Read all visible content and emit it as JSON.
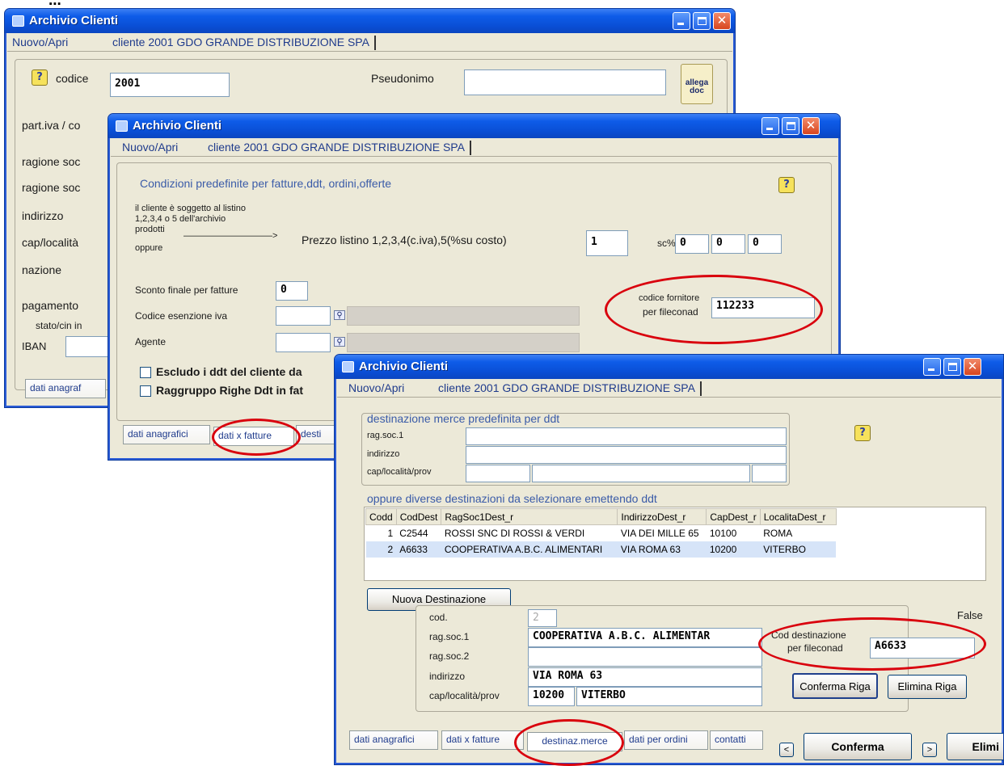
{
  "caption": "...",
  "windows": [
    {
      "title": "Archivio Clienti",
      "menu": {
        "open": "Nuovo/Apri",
        "client": "cliente 2001 GDO GRANDE DISTRIBUZIONE SPA"
      },
      "fields": {
        "codice_label": "codice",
        "codice_value": "2001",
        "pseudonimo_label": "Pseudonimo",
        "pseudonimo_value": "",
        "partiva_label": "part.iva / co",
        "ragsoc1_label": "ragione soc",
        "ragsoc2_label": "ragione soc",
        "indirizzo_label": "indirizzo",
        "cap_label": "cap/località",
        "nazione_label": "nazione",
        "pagamento_label": "pagamento",
        "statocin_label": "stato/cin in",
        "iban_label": "IBAN",
        "allega_label": "allega doc"
      },
      "tab": "dati anagraf"
    },
    {
      "title": "Archivio Clienti",
      "menu": {
        "open": "Nuovo/Apri",
        "client": "cliente 2001 GDO GRANDE DISTRIBUZIONE SPA"
      },
      "group_title": "Condizioni predefinite per fatture,ddt, ordini,offerte",
      "listino_note": [
        "il cliente è soggetto al listino",
        "1,2,3,4 o 5 dell'archivio",
        "prodotti",
        "oppure"
      ],
      "prezzo_label": "Prezzo listino 1,2,3,4(c.iva),5(%su costo)",
      "prezzo_value": "1",
      "sc_label": "sc%",
      "sc_values": [
        "0",
        "0",
        "0"
      ],
      "sconto_label": "Sconto finale per fatture",
      "sconto_value": "0",
      "esenzione_label": "Codice esenzione iva",
      "agente_label": "Agente",
      "fornitore_label_1": "codice fornitore",
      "fornitore_label_2": "per fileconad",
      "fornitore_value": "112233",
      "check1": "Escludo i ddt del cliente da",
      "check2": "Raggruppo Righe Ddt in fat",
      "tabs": [
        "dati anagrafici",
        "dati x fatture",
        "desti"
      ]
    },
    {
      "title": "Archivio Clienti",
      "menu": {
        "open": "Nuovo/Apri",
        "client": "cliente 2001 GDO GRANDE DISTRIBUZIONE SPA"
      },
      "dest_title": "destinazione merce predefinita per ddt",
      "dest_labels": [
        "rag.soc.1",
        "indirizzo",
        "cap/località/prov"
      ],
      "multi_title": "oppure diverse destinazioni da selezionare emettendo ddt",
      "table": {
        "headers": [
          "Codd",
          "CodDest",
          "RagSoc1Dest_r",
          "IndirizzoDest_r",
          "CapDest_r",
          "LocalitaDest_r"
        ],
        "rows": [
          [
            "1",
            "C2544",
            "ROSSI SNC DI ROSSI & VERDI",
            "VIA DEI MILLE 65",
            "10100",
            "ROMA"
          ],
          [
            "2",
            "A6633",
            "COOPERATIVA A.B.C. ALIMENTARI",
            "VIA ROMA 63",
            "10200",
            "VITERBO"
          ]
        ]
      },
      "nuova_btn": "Nuova Destinazione",
      "false_label": "False",
      "form": {
        "cod_label": "cod.",
        "cod_value": "2",
        "ragsoc1_label": "rag.soc.1",
        "ragsoc1_value": "COOPERATIVA A.B.C. ALIMENTAR",
        "ragsoc2_label": "rag.soc.2",
        "ragsoc2_value": "",
        "indirizzo_label": "indirizzo",
        "indirizzo_value": "VIA ROMA 63",
        "cap_label": "cap/località/prov",
        "cap_value": "10200",
        "loc_value": "VITERBO"
      },
      "coddest_label_1": "Cod destinazione",
      "coddest_label_2": "per fileconad",
      "coddest_value": "A6633",
      "conferma_riga": "Conferma Riga",
      "elimina_riga": "Elimina Riga",
      "tabs": [
        "dati anagrafici",
        "dati x fatture",
        "destinaz.merce",
        "dati per ordini",
        "contatti"
      ],
      "conferma_btn": "Conferma",
      "elimina_btn": "Elimi",
      "nav_prev": "<",
      "nav_next": ">"
    }
  ],
  "colors": {
    "title_blue": "#0a4fd6",
    "highlight_red": "#d9000d",
    "face": "#ece9d8"
  }
}
